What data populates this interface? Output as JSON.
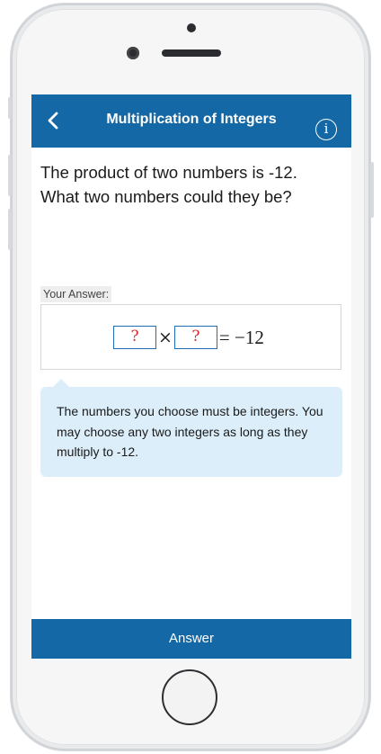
{
  "header": {
    "title": "Multiplication of Integers",
    "back_icon": "chevron-left-icon",
    "info_icon": "info-icon",
    "info_glyph": "i",
    "color": "#1468a6"
  },
  "question": {
    "line1": "The product of two numbers is -12.",
    "line2": "What two numbers could they be?"
  },
  "answer": {
    "label": "Your Answer:",
    "blank1": "?",
    "blank2": "?",
    "operator": "×",
    "rhs": "= −12"
  },
  "hint": {
    "text": "The numbers you choose must be integers. You may choose any two integers as long as they multiply to -12."
  },
  "footer": {
    "button_label": "Answer"
  }
}
